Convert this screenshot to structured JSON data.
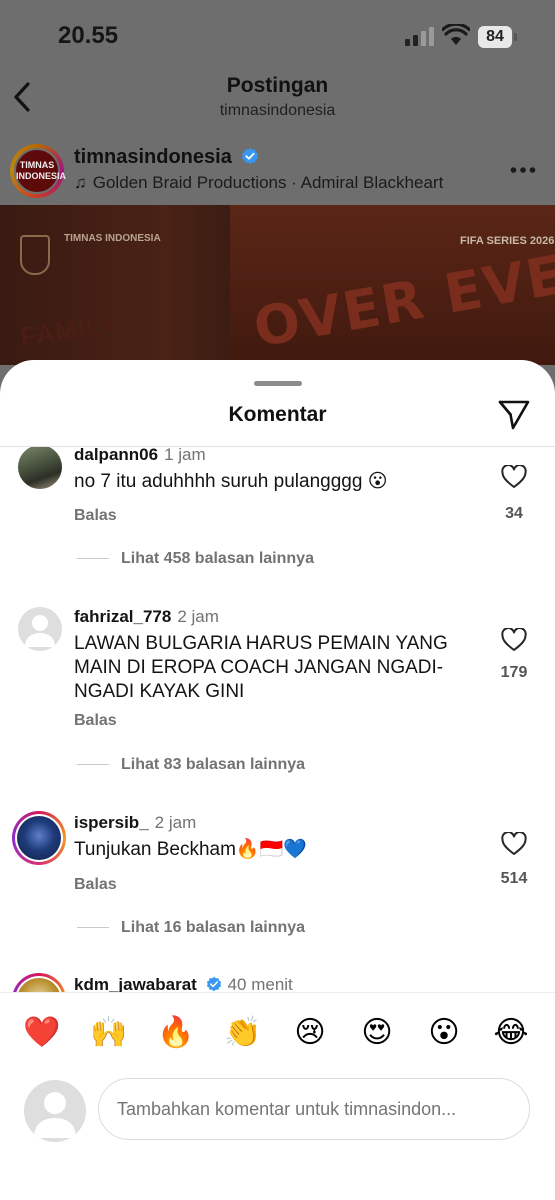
{
  "status_bar": {
    "time": "20.55",
    "battery": "84"
  },
  "header": {
    "title": "Postingan",
    "subtitle": "timnasindonesia"
  },
  "post": {
    "username": "timnasindonesia",
    "music": "Golden Braid Productions · Admiral Blackheart",
    "avatar_text": "TIMNAS INDONESIA",
    "image": {
      "logo_text": "TIMNAS INDONESIA",
      "fifa_text": "FIFA SERIES 2026",
      "wall_text": "OVER EVERYTHING",
      "family_text": "FAMILY"
    }
  },
  "sheet": {
    "title": "Komentar"
  },
  "comments": [
    {
      "username": "dalpann06",
      "time": "1 jam",
      "text": "no 7 itu aduhhhh suruh pulangggg 😮",
      "reply_label": "Balas",
      "likes": "34",
      "more_replies": "Lihat 458 balasan lainnya",
      "verified": false
    },
    {
      "username": "fahrizal_778",
      "time": "2 jam",
      "text": "LAWAN BULGARIA HARUS PEMAIN YANG MAIN DI EROPA COACH JANGAN NGADI-NGADI KAYAK GINI",
      "reply_label": "Balas",
      "likes": "179",
      "more_replies": "Lihat 83 balasan lainnya",
      "verified": false
    },
    {
      "username": "ispersib_",
      "time": "2 jam",
      "text": "Tunjukan Beckham🔥🇮🇩💙",
      "reply_label": "Balas",
      "likes": "514",
      "more_replies": "Lihat 16 balasan lainnya",
      "verified": false
    },
    {
      "username": "kdm_jawabarat",
      "time": "40 menit",
      "verified": true
    }
  ],
  "quick_reactions": [
    "❤️",
    "🙌",
    "🔥",
    "👏",
    "😢",
    "😍",
    "😮",
    "😂"
  ],
  "composer": {
    "placeholder": "Tambahkan komentar untuk timnasindon..."
  },
  "colors": {
    "heart_red": "#ed1c3a",
    "verified_blue": "#3897f0",
    "muted_text": "#737373"
  }
}
